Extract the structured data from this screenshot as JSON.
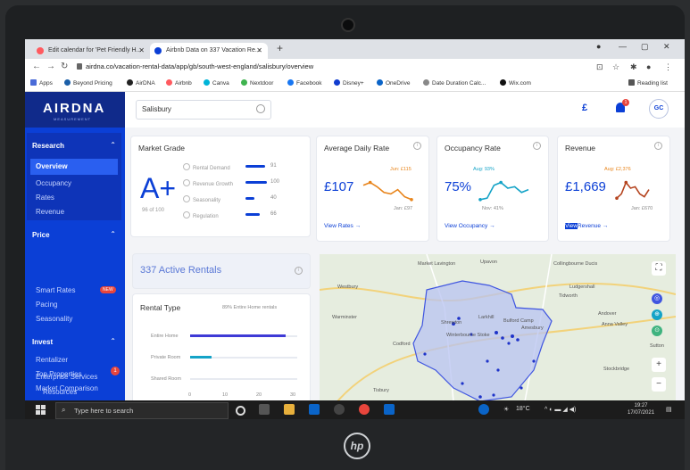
{
  "browser": {
    "tabs": [
      {
        "title": "Edit calendar for 'Pet Friendly H..."
      },
      {
        "title": "Airbnb Data on 337 Vacation Re..."
      }
    ],
    "url": "airdna.co/vacation-rental-data/app/gb/south-west-england/salisbury/overview",
    "bookmarks": [
      "Apps",
      "Beyond Pricing",
      "AirDNA",
      "Airbnb",
      "Canva",
      "Nextdoor",
      "Facebook",
      "Disney+",
      "OneDrive",
      "Date Duration Calc...",
      "Wix.com"
    ],
    "reading_list": "Reading list"
  },
  "sidebar": {
    "brand": "AIRDNA",
    "brand_sub": "MEASUREMENT",
    "research": {
      "title": "Research",
      "items": [
        "Overview",
        "Occupancy",
        "Rates",
        "Revenue"
      ]
    },
    "price": {
      "title": "Price",
      "items": [
        "Smart Rates",
        "Pacing",
        "Seasonality"
      ],
      "badge": "NEW"
    },
    "invest": {
      "title": "Invest",
      "items": [
        "Rentalizer",
        "Top Properties",
        "Market Comparison"
      ]
    },
    "enterprise": {
      "label": "Enterprise Services",
      "badge": "1"
    },
    "resources": "Resources"
  },
  "topbar": {
    "search_value": "Salisbury",
    "currency": "£",
    "notification_count": "1",
    "avatar": "GC"
  },
  "market_grade": {
    "title": "Market Grade",
    "grade": "A+",
    "score": "96 of 100",
    "metrics": [
      {
        "label": "Rental Demand",
        "value": "91",
        "fill": 0.91
      },
      {
        "label": "Revenue Growth",
        "value": "100",
        "fill": 1.0
      },
      {
        "label": "Seasonality",
        "value": "40",
        "fill": 0.4
      },
      {
        "label": "Regulation",
        "value": "66",
        "fill": 0.66
      }
    ]
  },
  "adr": {
    "title": "Average Daily Rate",
    "value": "£107",
    "high": "Jun: £115",
    "low": "Jan: £97",
    "link": "View Rates →",
    "spark": [
      0.6,
      0.7,
      0.55,
      0.35,
      0.3,
      0.45,
      0.2,
      0.1
    ]
  },
  "occupancy": {
    "title": "Occupancy Rate",
    "value": "75%",
    "high": "Aug: 93%",
    "low": "Nov: 41%",
    "link": "View Occupancy →",
    "spark": [
      0.1,
      0.15,
      0.6,
      0.7,
      0.5,
      0.55,
      0.35,
      0.45
    ]
  },
  "revenue": {
    "title": "Revenue",
    "value": "£1,669",
    "high": "Aug: £2,376",
    "low": "Jan: £670",
    "link_sel": "View",
    "link_rest": "Revenue →",
    "spark": [
      0.15,
      0.3,
      0.7,
      0.5,
      0.55,
      0.3,
      0.2,
      0.45
    ]
  },
  "active_rentals": {
    "title": "337 Active Rentals"
  },
  "rental_type": {
    "title": "Rental Type",
    "legend": "89% Entire Home rentals",
    "rows": [
      {
        "label": "Entire Home",
        "fill": 0.89
      },
      {
        "label": "Private Room",
        "fill": 0.2
      },
      {
        "label": "Shared Room",
        "fill": 0.0
      }
    ],
    "ticks": [
      "0",
      "10",
      "20",
      "30"
    ]
  },
  "map": {
    "labels": [
      "Market Lavington",
      "Upavon",
      "Collingbourne Ducis",
      "Ludgershall",
      "Tidworth",
      "Westbury",
      "Andover",
      "Anna Valley",
      "Warminster",
      "Stockbridge",
      "Sutton",
      "Shrewton",
      "Larkhill",
      "Bulford Camp",
      "Winterbourne Stoke",
      "Tisbury",
      "Amesbury",
      "Codford"
    ]
  },
  "taskbar": {
    "search_placeholder": "Type here to search",
    "weather": "18°C",
    "time": "19:27",
    "date": "17/07/2021"
  },
  "colors": {
    "primary": "#0b3fd6",
    "accent": "#e8841a",
    "teal": "#14a3c7",
    "badge": "#e8453c"
  }
}
